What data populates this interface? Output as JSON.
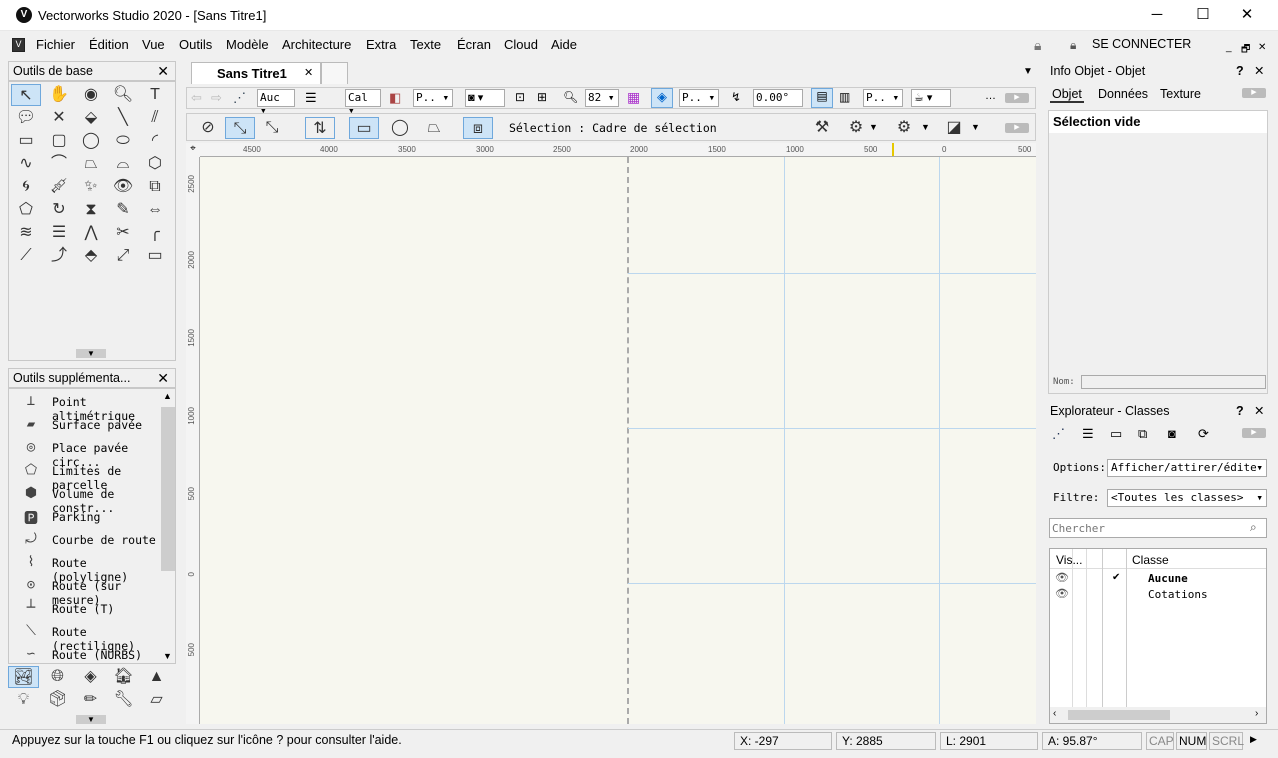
{
  "window": {
    "title": "Vectorworks Studio 2020 - [Sans Titre1]",
    "logo": "V"
  },
  "menu": [
    "Fichier",
    "Édition",
    "Vue",
    "Outils",
    "Modèle",
    "Architecture",
    "Extra",
    "Texte",
    "Écran",
    "Cloud",
    "Aide"
  ],
  "account": {
    "label": "SE CONNECTER"
  },
  "base_tools": {
    "title": "Outils de base"
  },
  "extra_tools": {
    "title": "Outils supplémenta...",
    "items": [
      "Point altimétrique",
      "Surface pavée",
      "Place pavée circ...",
      "Limites de parcelle",
      "Volume de constr...",
      "Parking",
      "Courbe de route",
      "Route (polyligne)",
      "Route (sur mesure)",
      "Route (T)",
      "Route (rectiligne)",
      "Route (NURBS)"
    ]
  },
  "doc": {
    "tab": "Sans Titre1",
    "view_toolbar": {
      "layer": "Auc",
      "class": "Cal",
      "plane": "P..",
      "zoom": "82",
      "render": "P..",
      "angle": "0.00°",
      "proj": "P.."
    },
    "mode_toolbar": {
      "status": "Sélection : Cadre de sélection"
    },
    "ruler_h": [
      "4500",
      "4000",
      "3500",
      "3000",
      "2500",
      "2000",
      "1500",
      "1000",
      "500",
      "0",
      "500"
    ],
    "ruler_v": [
      "2500",
      "2000",
      "1500",
      "1000",
      "500",
      "0",
      "500"
    ]
  },
  "info_panel": {
    "title": "Info Objet - Objet",
    "tabs": [
      "Objet",
      "Données",
      "Texture"
    ],
    "selection": "Sélection vide",
    "name_label": "Nom:"
  },
  "explorer": {
    "title": "Explorateur - Classes",
    "options_label": "Options:",
    "options_value": "Afficher/attirer/éditer",
    "filter_label": "Filtre:",
    "filter_value": "<Toutes les classes>",
    "search_placeholder": "Chercher",
    "col_vis": "Vis...",
    "col_class": "Classe",
    "rows": [
      {
        "name": "Aucune",
        "active": "✔"
      },
      {
        "name": "Cotations",
        "active": ""
      }
    ]
  },
  "status": {
    "help": "Appuyez sur la touche F1 ou cliquez sur l'icône ? pour consulter l'aide.",
    "x": "X: -297",
    "y": "Y: 2885",
    "l": "L: 2901",
    "a": "A: 95.87°",
    "cap": "CAP",
    "num": "NUM",
    "scrl": "SCRL"
  }
}
